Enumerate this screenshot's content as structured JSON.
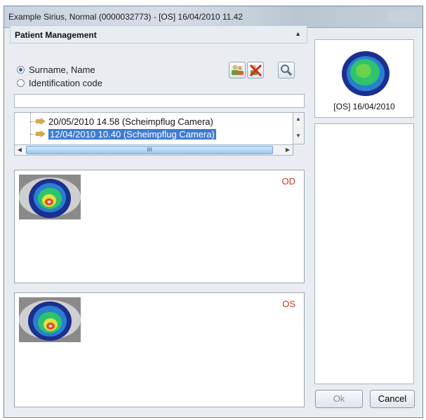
{
  "window": {
    "title": "Example Sirius, Normal (0000032773) - [OS] 16/04/2010 11.42"
  },
  "patient_management": {
    "title": "Patient Management",
    "search_modes": [
      {
        "label": "Surname, Name",
        "selected": true
      },
      {
        "label": "Identification code",
        "selected": false
      }
    ],
    "toolbar_icons": [
      "patients-group-icon",
      "delete-patient-icon",
      "magnifier-icon"
    ],
    "search_value": "",
    "exams": [
      {
        "label": "20/05/2010 14.58 (Scheimpflug Camera)",
        "selected": false
      },
      {
        "label": "12/04/2010 10.40 (Scheimpflug Camera)",
        "selected": true
      }
    ],
    "scroll_grip": "III"
  },
  "eye_panels": [
    {
      "label": "OD"
    },
    {
      "label": "OS"
    }
  ],
  "preview": {
    "caption": "[OS] 16/04/2010"
  },
  "buttons": {
    "ok": "Ok",
    "cancel": "Cancel"
  },
  "colors": {
    "selection": "#3f7bd1",
    "eye_label": "#c0392b"
  }
}
